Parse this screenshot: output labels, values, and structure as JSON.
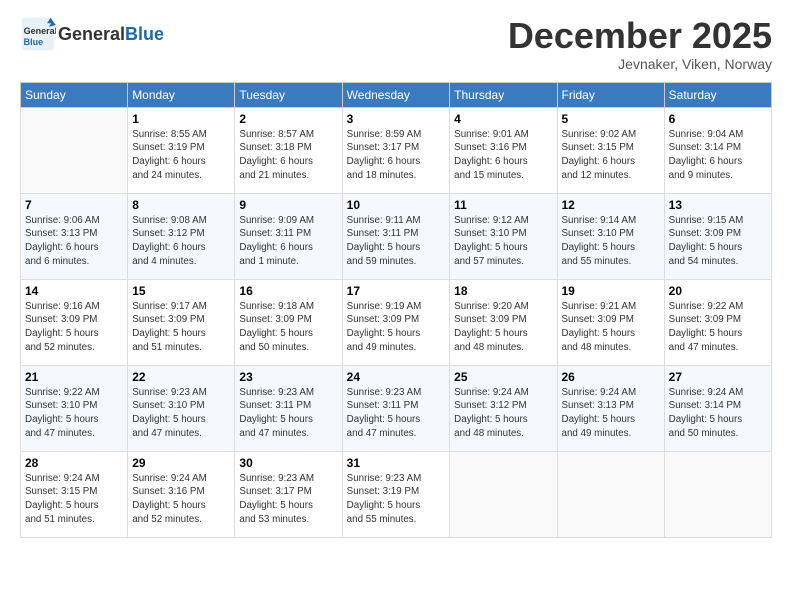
{
  "header": {
    "logo_general": "General",
    "logo_blue": "Blue",
    "month_title": "December 2025",
    "subtitle": "Jevnaker, Viken, Norway"
  },
  "weekdays": [
    "Sunday",
    "Monday",
    "Tuesday",
    "Wednesday",
    "Thursday",
    "Friday",
    "Saturday"
  ],
  "weeks": [
    [
      {
        "day": "",
        "info": ""
      },
      {
        "day": "1",
        "info": "Sunrise: 8:55 AM\nSunset: 3:19 PM\nDaylight: 6 hours\nand 24 minutes."
      },
      {
        "day": "2",
        "info": "Sunrise: 8:57 AM\nSunset: 3:18 PM\nDaylight: 6 hours\nand 21 minutes."
      },
      {
        "day": "3",
        "info": "Sunrise: 8:59 AM\nSunset: 3:17 PM\nDaylight: 6 hours\nand 18 minutes."
      },
      {
        "day": "4",
        "info": "Sunrise: 9:01 AM\nSunset: 3:16 PM\nDaylight: 6 hours\nand 15 minutes."
      },
      {
        "day": "5",
        "info": "Sunrise: 9:02 AM\nSunset: 3:15 PM\nDaylight: 6 hours\nand 12 minutes."
      },
      {
        "day": "6",
        "info": "Sunrise: 9:04 AM\nSunset: 3:14 PM\nDaylight: 6 hours\nand 9 minutes."
      }
    ],
    [
      {
        "day": "7",
        "info": "Sunrise: 9:06 AM\nSunset: 3:13 PM\nDaylight: 6 hours\nand 6 minutes."
      },
      {
        "day": "8",
        "info": "Sunrise: 9:08 AM\nSunset: 3:12 PM\nDaylight: 6 hours\nand 4 minutes."
      },
      {
        "day": "9",
        "info": "Sunrise: 9:09 AM\nSunset: 3:11 PM\nDaylight: 6 hours\nand 1 minute."
      },
      {
        "day": "10",
        "info": "Sunrise: 9:11 AM\nSunset: 3:11 PM\nDaylight: 5 hours\nand 59 minutes."
      },
      {
        "day": "11",
        "info": "Sunrise: 9:12 AM\nSunset: 3:10 PM\nDaylight: 5 hours\nand 57 minutes."
      },
      {
        "day": "12",
        "info": "Sunrise: 9:14 AM\nSunset: 3:10 PM\nDaylight: 5 hours\nand 55 minutes."
      },
      {
        "day": "13",
        "info": "Sunrise: 9:15 AM\nSunset: 3:09 PM\nDaylight: 5 hours\nand 54 minutes."
      }
    ],
    [
      {
        "day": "14",
        "info": "Sunrise: 9:16 AM\nSunset: 3:09 PM\nDaylight: 5 hours\nand 52 minutes."
      },
      {
        "day": "15",
        "info": "Sunrise: 9:17 AM\nSunset: 3:09 PM\nDaylight: 5 hours\nand 51 minutes."
      },
      {
        "day": "16",
        "info": "Sunrise: 9:18 AM\nSunset: 3:09 PM\nDaylight: 5 hours\nand 50 minutes."
      },
      {
        "day": "17",
        "info": "Sunrise: 9:19 AM\nSunset: 3:09 PM\nDaylight: 5 hours\nand 49 minutes."
      },
      {
        "day": "18",
        "info": "Sunrise: 9:20 AM\nSunset: 3:09 PM\nDaylight: 5 hours\nand 48 minutes."
      },
      {
        "day": "19",
        "info": "Sunrise: 9:21 AM\nSunset: 3:09 PM\nDaylight: 5 hours\nand 48 minutes."
      },
      {
        "day": "20",
        "info": "Sunrise: 9:22 AM\nSunset: 3:09 PM\nDaylight: 5 hours\nand 47 minutes."
      }
    ],
    [
      {
        "day": "21",
        "info": "Sunrise: 9:22 AM\nSunset: 3:10 PM\nDaylight: 5 hours\nand 47 minutes."
      },
      {
        "day": "22",
        "info": "Sunrise: 9:23 AM\nSunset: 3:10 PM\nDaylight: 5 hours\nand 47 minutes."
      },
      {
        "day": "23",
        "info": "Sunrise: 9:23 AM\nSunset: 3:11 PM\nDaylight: 5 hours\nand 47 minutes."
      },
      {
        "day": "24",
        "info": "Sunrise: 9:23 AM\nSunset: 3:11 PM\nDaylight: 5 hours\nand 47 minutes."
      },
      {
        "day": "25",
        "info": "Sunrise: 9:24 AM\nSunset: 3:12 PM\nDaylight: 5 hours\nand 48 minutes."
      },
      {
        "day": "26",
        "info": "Sunrise: 9:24 AM\nSunset: 3:13 PM\nDaylight: 5 hours\nand 49 minutes."
      },
      {
        "day": "27",
        "info": "Sunrise: 9:24 AM\nSunset: 3:14 PM\nDaylight: 5 hours\nand 50 minutes."
      }
    ],
    [
      {
        "day": "28",
        "info": "Sunrise: 9:24 AM\nSunset: 3:15 PM\nDaylight: 5 hours\nand 51 minutes."
      },
      {
        "day": "29",
        "info": "Sunrise: 9:24 AM\nSunset: 3:16 PM\nDaylight: 5 hours\nand 52 minutes."
      },
      {
        "day": "30",
        "info": "Sunrise: 9:23 AM\nSunset: 3:17 PM\nDaylight: 5 hours\nand 53 minutes."
      },
      {
        "day": "31",
        "info": "Sunrise: 9:23 AM\nSunset: 3:19 PM\nDaylight: 5 hours\nand 55 minutes."
      },
      {
        "day": "",
        "info": ""
      },
      {
        "day": "",
        "info": ""
      },
      {
        "day": "",
        "info": ""
      }
    ]
  ]
}
